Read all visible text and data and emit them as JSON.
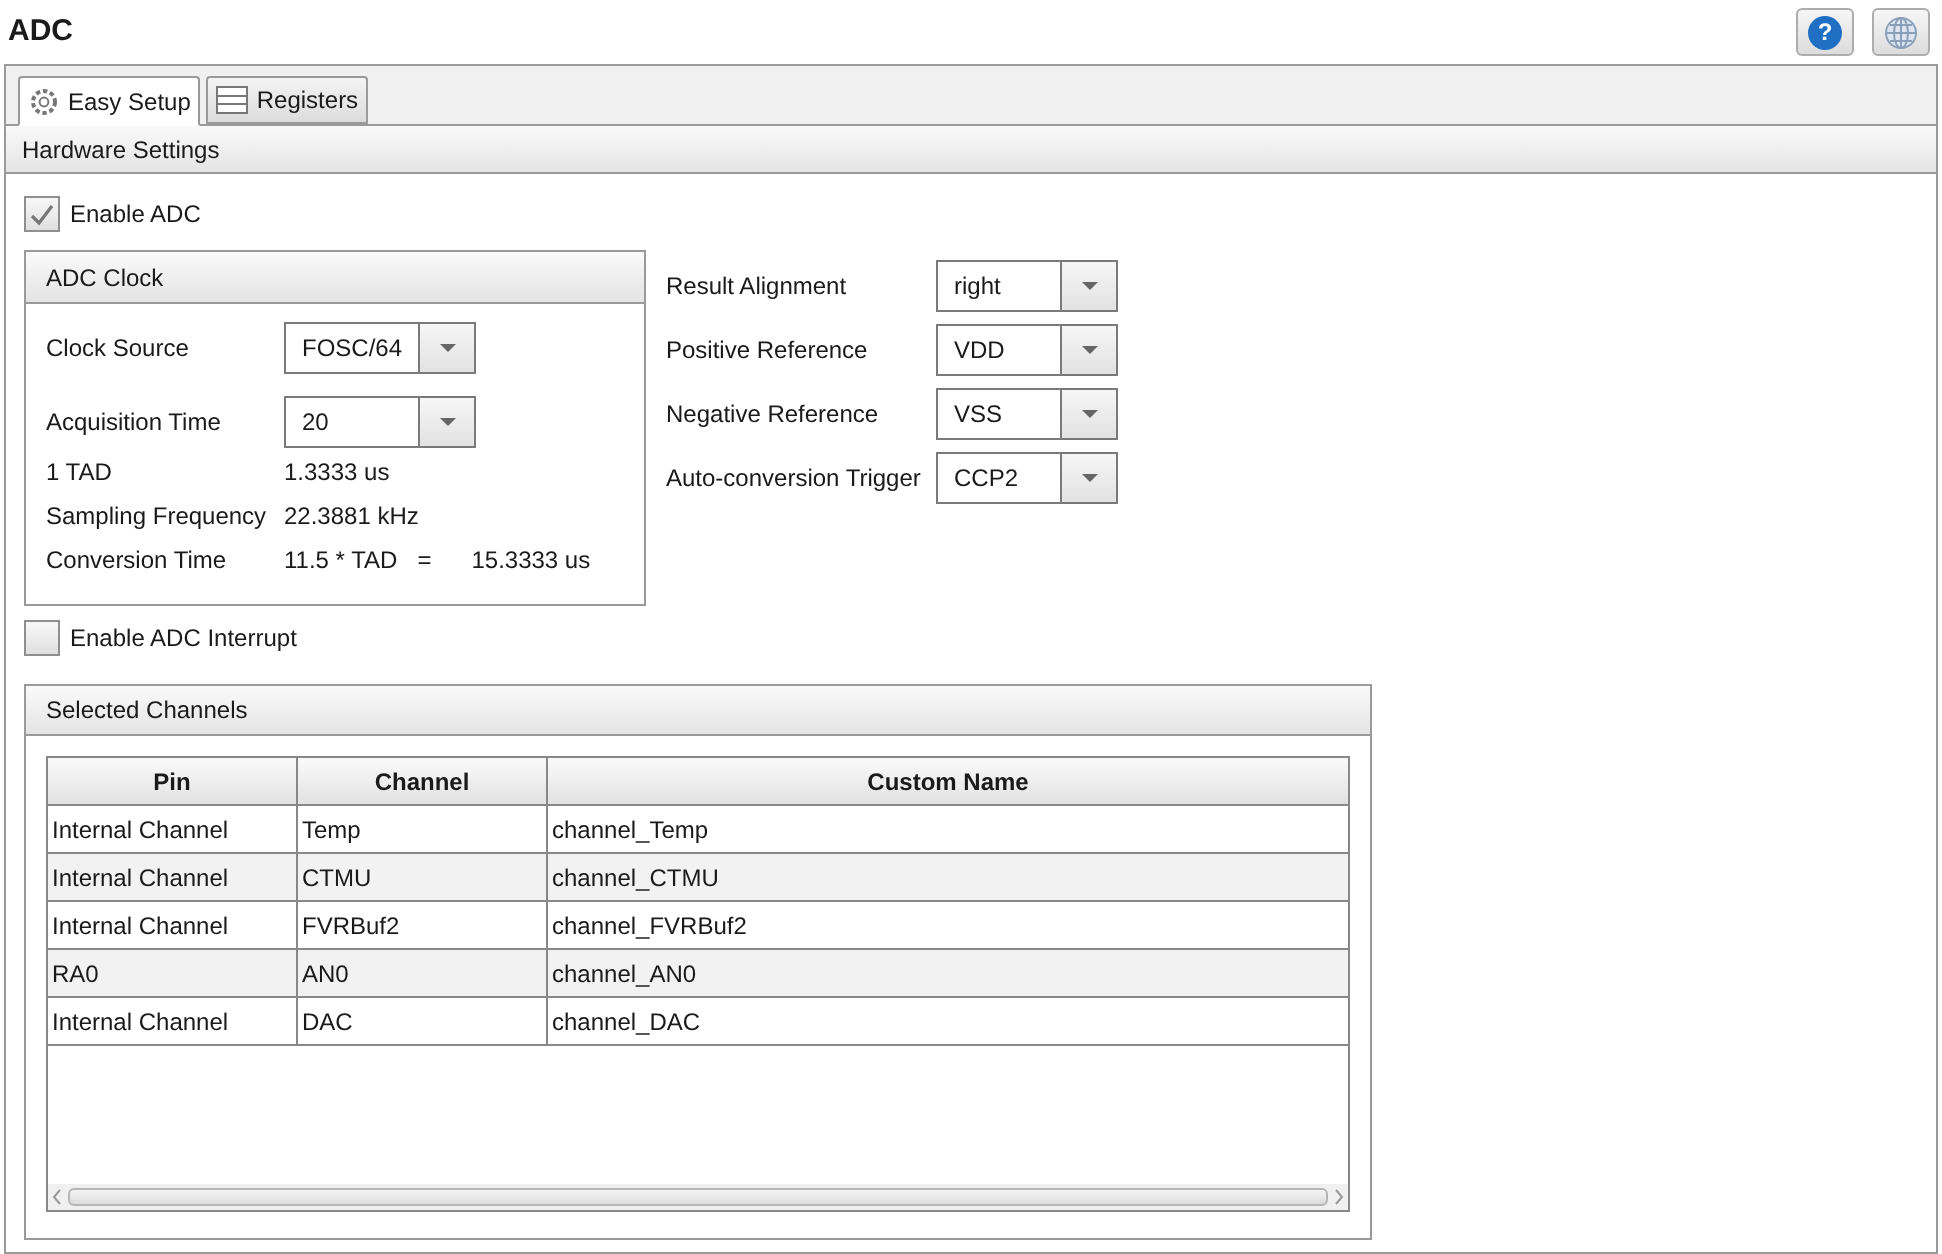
{
  "window": {
    "title": "ADC"
  },
  "toolbar": {
    "help_label": "?"
  },
  "tabs": [
    {
      "label": "Easy Setup",
      "kind": "setup",
      "selected": true
    },
    {
      "label": "Registers",
      "kind": "registers",
      "selected": false
    }
  ],
  "section": {
    "title": "Hardware Settings"
  },
  "enable_adc": {
    "label": "Enable ADC",
    "checked": true
  },
  "adc_clock": {
    "title": "ADC Clock",
    "dropdowns": [
      {
        "label": "Clock Source",
        "value": "FOSC/64"
      },
      {
        "label": "Acquisition Time",
        "value": "20"
      }
    ],
    "readouts": [
      {
        "label": "1 TAD",
        "value": "1.3333 us"
      },
      {
        "label": "Sampling Frequency",
        "value": "22.3881 kHz"
      },
      {
        "label": "Conversion Time",
        "value": "11.5 * TAD",
        "equals": "=",
        "result": "15.3333 us"
      }
    ]
  },
  "settings": [
    {
      "label": "Result Alignment",
      "value": "right"
    },
    {
      "label": "Positive Reference",
      "value": "VDD"
    },
    {
      "label": "Negative Reference",
      "value": "VSS"
    },
    {
      "label": "Auto-conversion Trigger",
      "value": "CCP2"
    }
  ],
  "enable_interrupt": {
    "label": "Enable ADC Interrupt",
    "checked": false
  },
  "selected_channels": {
    "title": "Selected Channels",
    "columns": [
      "Pin",
      "Channel",
      "Custom Name"
    ],
    "rows": [
      [
        "Internal Channel",
        "Temp",
        "channel_Temp"
      ],
      [
        "Internal Channel",
        "CTMU",
        "channel_CTMU"
      ],
      [
        "Internal Channel",
        "FVRBuf2",
        "channel_FVRBuf2"
      ],
      [
        "RA0",
        "AN0",
        "channel_AN0"
      ],
      [
        "Internal Channel",
        "DAC",
        "channel_DAC"
      ]
    ]
  }
}
